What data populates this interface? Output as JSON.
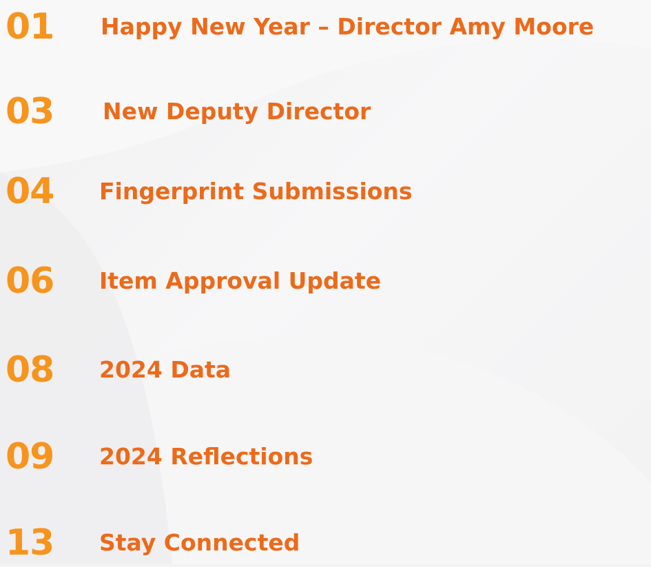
{
  "toc": {
    "entries": [
      {
        "page": "01",
        "title": "Happy New Year – Director Amy Moore"
      },
      {
        "page": "03",
        "title": "New Deputy Director"
      },
      {
        "page": "04",
        "title": "Fingerprint Submissions"
      },
      {
        "page": "06",
        "title": "Item Approval Update"
      },
      {
        "page": "08",
        "title": "2024 Data"
      },
      {
        "page": "09",
        "title": "2024 Reflections"
      },
      {
        "page": "13",
        "title": "Stay Connected"
      }
    ]
  },
  "colors": {
    "page_number": "#f7941d",
    "title_text": "#ec6a1a",
    "background": "#f3f3f4"
  }
}
